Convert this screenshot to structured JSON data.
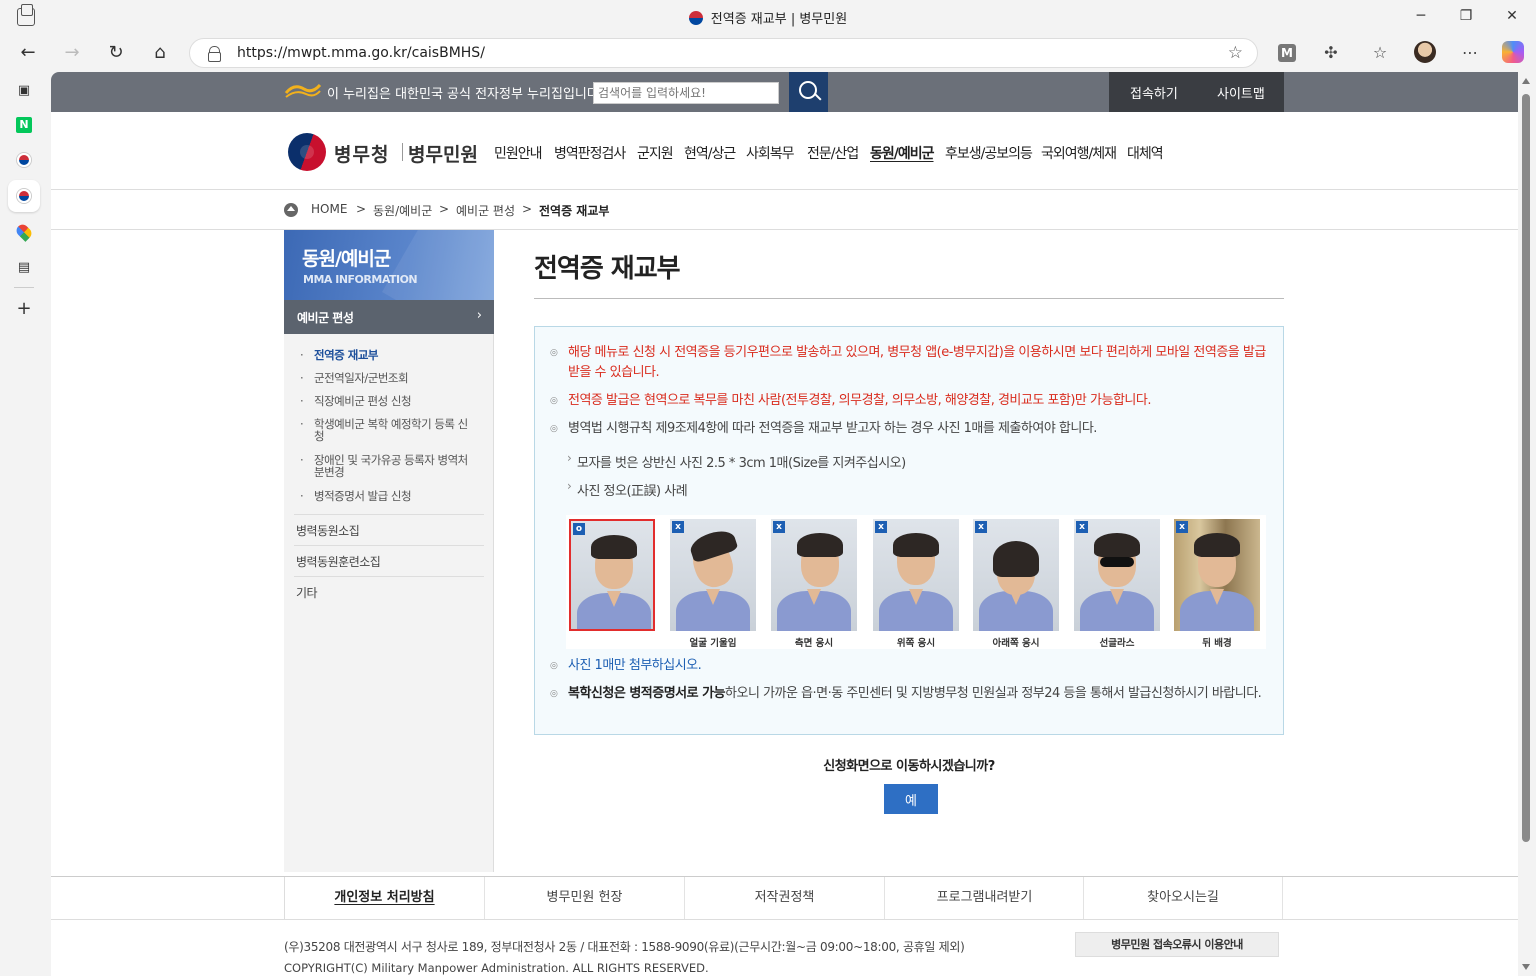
{
  "browser": {
    "tab_title": "전역증 재교부 | 병무민원",
    "url": "https://mwpt.mma.go.kr/caisBMHS/",
    "minimize": "─",
    "restore": "❐",
    "close": "✕",
    "ext_badge": "M"
  },
  "sidebar_icons": [
    "collections-icon",
    "naver-icon",
    "mma-icon",
    "mma-active-icon",
    "maps-icon",
    "calendar-icon",
    "add-icon"
  ],
  "naver_label": "N",
  "govbar": {
    "notice": "이 누리집은 대한민국 공식 전자정부 누리집입니다.",
    "search_placeholder": "검색어를 입력하세요!",
    "login": "접속하기",
    "sitemap": "사이트맵"
  },
  "header": {
    "logo_main": "병무청",
    "logo_sub": "병무민원",
    "menu": [
      "민원안내",
      "병역판정검사",
      "군지원",
      "현역/상근",
      "사회복무",
      "전문/산업",
      "동원/예비군",
      "후보생/공보의등",
      "국외여행/체재",
      "대체역"
    ],
    "active_menu": "동원/예비군"
  },
  "breadcrumb": {
    "items": [
      "HOME",
      "동원/예비군",
      "예비군 편성",
      "전역증 재교부"
    ],
    "sep": ">"
  },
  "lnb": {
    "title": "동원/예비군",
    "subtitle": "MMA INFORMATION",
    "selected": "예비군 편성",
    "sub_items": [
      "전역증 재교부",
      "군전역일자/군번조회",
      "직장예비군 편성 신청",
      "학생예비군 복학 예정학기 등록 신청",
      "장애인 및 국가유공 등록자 병역처분변경",
      "병적증명서 발급 신청"
    ],
    "main_items": [
      "병력동원소집",
      "병력동원훈련소집",
      "기타"
    ]
  },
  "content": {
    "title": "전역증 재교부",
    "bullets": {
      "b1": "해당 메뉴로 신청 시 전역증을 등기우편으로 발송하고 있으며, 병무청 앱(e-병무지갑)을 이용하시면 보다 편리하게 모바일 전역증을 발급 받을 수 있습니다.",
      "b2": "전역증 발급은 현역으로 복무를 마친 사람(전투경찰, 의무경찰, 의무소방, 해양경찰, 경비교도 포함)만 가능합니다.",
      "b3": "병역법 시행규칙 제9조제4항에 따라 전역증을 재교부 받고자 하는 경우 사진 1매를 제출하여야 합니다.",
      "sub1": "모자를 벗은 상반신 사진 2.5 * 3cm 1매(Size를 지켜주십시오)",
      "sub2": "사진 정오(正誤) 사례",
      "b4": "사진 1매만 첨부하십시오.",
      "b5_bold": "복학신청은 병적증명서로 가능",
      "b5_rest": "하오니 가까운 읍·면·동 주민센터 및 지방병무청 민원실과 정부24 등을 통해서 발급신청하시기 바랍니다."
    },
    "photos": [
      {
        "mark": "o",
        "caption": ""
      },
      {
        "mark": "x",
        "caption": "얼굴 기울임"
      },
      {
        "mark": "x",
        "caption": "측면 응시"
      },
      {
        "mark": "x",
        "caption": "위쪽 응시"
      },
      {
        "mark": "x",
        "caption": "아래쪽 응시"
      },
      {
        "mark": "x",
        "caption": "선글라스"
      },
      {
        "mark": "x",
        "caption": "뒤 배경"
      }
    ],
    "question": "신청화면으로 이동하시겠습니까?",
    "yes_button": "예"
  },
  "footer": {
    "links": [
      "개인정보 처리방침",
      "병무민원 헌장",
      "저작권정책",
      "프로그램내려받기",
      "찾아오시는길"
    ],
    "address": "(우)35208 대전광역시 서구 청사로 189, 정부대전청사 2동 / 대표전화 : 1588-9090(유료)(근무시간:월~금 09:00~18:00, 공휴일 제외)",
    "copyright": "COPYRIGHT(C) Military Manpower Administration. ALL RIGHTS RESERVED.",
    "error_guide": "병무민원 접속오류시 이용안내"
  }
}
